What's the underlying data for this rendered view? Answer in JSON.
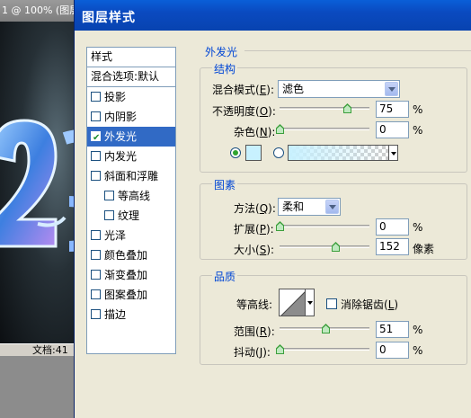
{
  "background_window": {
    "title": "1 @ 100% (图层",
    "status": "文档:41"
  },
  "dialog": {
    "title": "图层样式",
    "style_list": {
      "header": "样式",
      "blend_options": "混合选项:默认",
      "items": [
        {
          "label": "投影",
          "checked": false,
          "selected": false
        },
        {
          "label": "内阴影",
          "checked": false,
          "selected": false
        },
        {
          "label": "外发光",
          "checked": true,
          "selected": true
        },
        {
          "label": "内发光",
          "checked": false,
          "selected": false
        },
        {
          "label": "斜面和浮雕",
          "checked": false,
          "selected": false
        },
        {
          "label": "等高线",
          "checked": false,
          "selected": false
        },
        {
          "label": "纹理",
          "checked": false,
          "selected": false
        },
        {
          "label": "光泽",
          "checked": false,
          "selected": false
        },
        {
          "label": "颜色叠加",
          "checked": false,
          "selected": false
        },
        {
          "label": "渐变叠加",
          "checked": false,
          "selected": false
        },
        {
          "label": "图案叠加",
          "checked": false,
          "selected": false
        },
        {
          "label": "描边",
          "checked": false,
          "selected": false
        }
      ]
    },
    "outer_glow": {
      "section_title": "外发光",
      "structure": {
        "title": "结构",
        "blend_mode": {
          "label": "混合模式",
          "key": "E",
          "value": "滤色"
        },
        "opacity": {
          "label": "不透明度",
          "key": "O",
          "value": "75",
          "unit": "%",
          "level": 75
        },
        "noise": {
          "label": "杂色",
          "key": "N",
          "value": "0",
          "unit": "%",
          "level": 0
        },
        "glow_color": "#c8f1ff"
      },
      "elements": {
        "title": "图素",
        "method": {
          "label": "方法",
          "key": "Q",
          "value": "柔和"
        },
        "spread": {
          "label": "扩展",
          "key": "P",
          "value": "0",
          "unit": "%",
          "level": 0
        },
        "size": {
          "label": "大小",
          "key": "S",
          "value": "152",
          "unit": "像素",
          "level": 62
        }
      },
      "quality": {
        "title": "品质",
        "contour": {
          "label": "等高线:"
        },
        "anti_alias": {
          "label": "消除锯齿",
          "key": "L",
          "checked": false
        },
        "range": {
          "label": "范围",
          "key": "R",
          "value": "51",
          "unit": "%",
          "level": 51
        },
        "jitter": {
          "label": "抖动",
          "key": "J",
          "value": "0",
          "unit": "%",
          "level": 0
        }
      }
    }
  }
}
